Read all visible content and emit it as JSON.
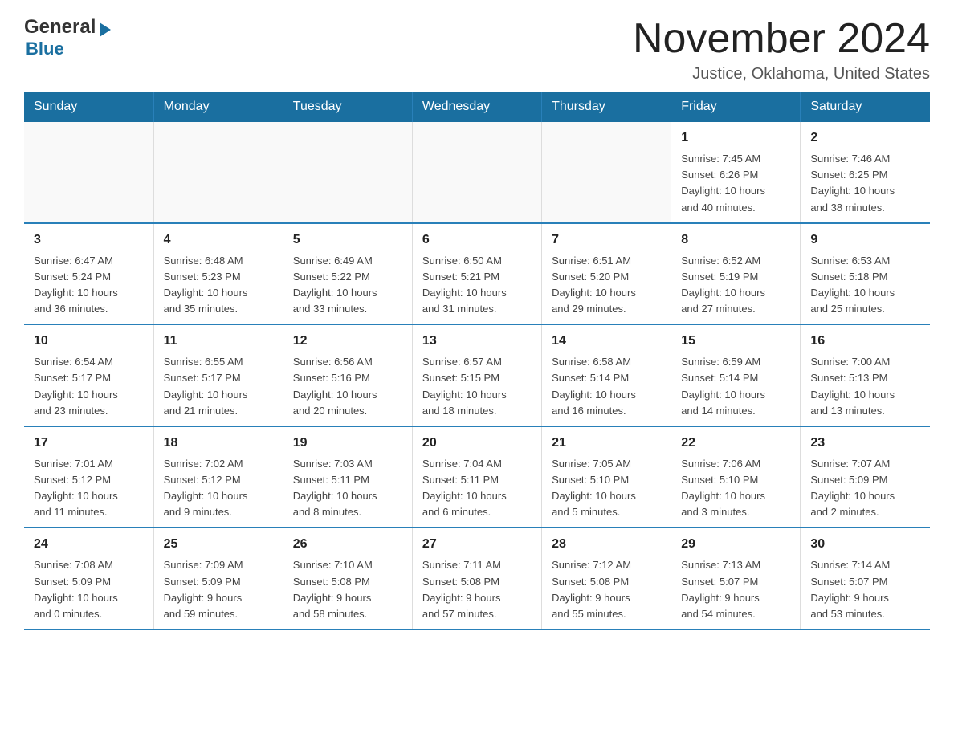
{
  "header": {
    "logo_general": "General",
    "logo_blue": "Blue",
    "month_title": "November 2024",
    "location": "Justice, Oklahoma, United States"
  },
  "weekdays": [
    "Sunday",
    "Monday",
    "Tuesday",
    "Wednesday",
    "Thursday",
    "Friday",
    "Saturday"
  ],
  "weeks": [
    [
      {
        "day": "",
        "info": ""
      },
      {
        "day": "",
        "info": ""
      },
      {
        "day": "",
        "info": ""
      },
      {
        "day": "",
        "info": ""
      },
      {
        "day": "",
        "info": ""
      },
      {
        "day": "1",
        "info": "Sunrise: 7:45 AM\nSunset: 6:26 PM\nDaylight: 10 hours\nand 40 minutes."
      },
      {
        "day": "2",
        "info": "Sunrise: 7:46 AM\nSunset: 6:25 PM\nDaylight: 10 hours\nand 38 minutes."
      }
    ],
    [
      {
        "day": "3",
        "info": "Sunrise: 6:47 AM\nSunset: 5:24 PM\nDaylight: 10 hours\nand 36 minutes."
      },
      {
        "day": "4",
        "info": "Sunrise: 6:48 AM\nSunset: 5:23 PM\nDaylight: 10 hours\nand 35 minutes."
      },
      {
        "day": "5",
        "info": "Sunrise: 6:49 AM\nSunset: 5:22 PM\nDaylight: 10 hours\nand 33 minutes."
      },
      {
        "day": "6",
        "info": "Sunrise: 6:50 AM\nSunset: 5:21 PM\nDaylight: 10 hours\nand 31 minutes."
      },
      {
        "day": "7",
        "info": "Sunrise: 6:51 AM\nSunset: 5:20 PM\nDaylight: 10 hours\nand 29 minutes."
      },
      {
        "day": "8",
        "info": "Sunrise: 6:52 AM\nSunset: 5:19 PM\nDaylight: 10 hours\nand 27 minutes."
      },
      {
        "day": "9",
        "info": "Sunrise: 6:53 AM\nSunset: 5:18 PM\nDaylight: 10 hours\nand 25 minutes."
      }
    ],
    [
      {
        "day": "10",
        "info": "Sunrise: 6:54 AM\nSunset: 5:17 PM\nDaylight: 10 hours\nand 23 minutes."
      },
      {
        "day": "11",
        "info": "Sunrise: 6:55 AM\nSunset: 5:17 PM\nDaylight: 10 hours\nand 21 minutes."
      },
      {
        "day": "12",
        "info": "Sunrise: 6:56 AM\nSunset: 5:16 PM\nDaylight: 10 hours\nand 20 minutes."
      },
      {
        "day": "13",
        "info": "Sunrise: 6:57 AM\nSunset: 5:15 PM\nDaylight: 10 hours\nand 18 minutes."
      },
      {
        "day": "14",
        "info": "Sunrise: 6:58 AM\nSunset: 5:14 PM\nDaylight: 10 hours\nand 16 minutes."
      },
      {
        "day": "15",
        "info": "Sunrise: 6:59 AM\nSunset: 5:14 PM\nDaylight: 10 hours\nand 14 minutes."
      },
      {
        "day": "16",
        "info": "Sunrise: 7:00 AM\nSunset: 5:13 PM\nDaylight: 10 hours\nand 13 minutes."
      }
    ],
    [
      {
        "day": "17",
        "info": "Sunrise: 7:01 AM\nSunset: 5:12 PM\nDaylight: 10 hours\nand 11 minutes."
      },
      {
        "day": "18",
        "info": "Sunrise: 7:02 AM\nSunset: 5:12 PM\nDaylight: 10 hours\nand 9 minutes."
      },
      {
        "day": "19",
        "info": "Sunrise: 7:03 AM\nSunset: 5:11 PM\nDaylight: 10 hours\nand 8 minutes."
      },
      {
        "day": "20",
        "info": "Sunrise: 7:04 AM\nSunset: 5:11 PM\nDaylight: 10 hours\nand 6 minutes."
      },
      {
        "day": "21",
        "info": "Sunrise: 7:05 AM\nSunset: 5:10 PM\nDaylight: 10 hours\nand 5 minutes."
      },
      {
        "day": "22",
        "info": "Sunrise: 7:06 AM\nSunset: 5:10 PM\nDaylight: 10 hours\nand 3 minutes."
      },
      {
        "day": "23",
        "info": "Sunrise: 7:07 AM\nSunset: 5:09 PM\nDaylight: 10 hours\nand 2 minutes."
      }
    ],
    [
      {
        "day": "24",
        "info": "Sunrise: 7:08 AM\nSunset: 5:09 PM\nDaylight: 10 hours\nand 0 minutes."
      },
      {
        "day": "25",
        "info": "Sunrise: 7:09 AM\nSunset: 5:09 PM\nDaylight: 9 hours\nand 59 minutes."
      },
      {
        "day": "26",
        "info": "Sunrise: 7:10 AM\nSunset: 5:08 PM\nDaylight: 9 hours\nand 58 minutes."
      },
      {
        "day": "27",
        "info": "Sunrise: 7:11 AM\nSunset: 5:08 PM\nDaylight: 9 hours\nand 57 minutes."
      },
      {
        "day": "28",
        "info": "Sunrise: 7:12 AM\nSunset: 5:08 PM\nDaylight: 9 hours\nand 55 minutes."
      },
      {
        "day": "29",
        "info": "Sunrise: 7:13 AM\nSunset: 5:07 PM\nDaylight: 9 hours\nand 54 minutes."
      },
      {
        "day": "30",
        "info": "Sunrise: 7:14 AM\nSunset: 5:07 PM\nDaylight: 9 hours\nand 53 minutes."
      }
    ]
  ]
}
